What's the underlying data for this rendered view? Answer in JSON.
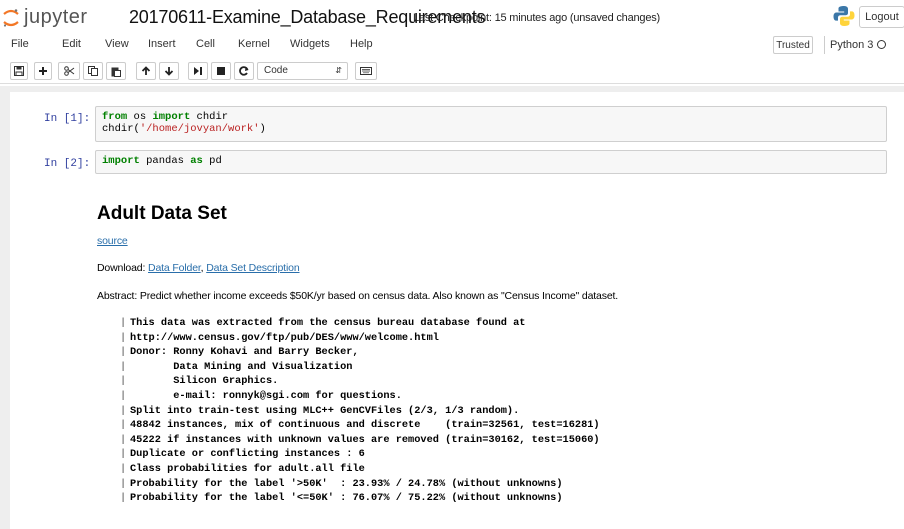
{
  "header": {
    "logo_text": "jupyter",
    "notebook_title": "20170611-Examine_Database_Requirements",
    "checkpoint": "Last Checkpoint: 15 minutes ago (unsaved changes)",
    "logout_label": "Logout"
  },
  "menubar": {
    "items": [
      "File",
      "Edit",
      "View",
      "Insert",
      "Cell",
      "Kernel",
      "Widgets",
      "Help"
    ],
    "trusted_label": "Trusted",
    "kernel_name": "Python 3"
  },
  "toolbar": {
    "buttons": [
      "save-icon",
      "add-icon",
      "cut-icon",
      "copy-icon",
      "paste-icon",
      "move-up-icon",
      "move-down-icon",
      "run-icon",
      "stop-icon",
      "restart-icon"
    ],
    "cell_type": "Code",
    "keyboard_icon": "keyboard-icon"
  },
  "cells": [
    {
      "prompt": "In [1]:",
      "lines": [
        [
          {
            "t": "from",
            "c": "kw"
          },
          {
            "t": " os "
          },
          {
            "t": "import",
            "c": "kw"
          },
          {
            "t": " chdir"
          }
        ],
        [
          {
            "t": "chdir("
          },
          {
            "t": "'/home/jovyan/work'",
            "c": "str"
          },
          {
            "t": ")"
          }
        ]
      ]
    },
    {
      "prompt": "In [2]:",
      "lines": [
        [
          {
            "t": "import",
            "c": "kw"
          },
          {
            "t": " pandas "
          },
          {
            "t": "as",
            "c": "kw"
          },
          {
            "t": " pd"
          }
        ]
      ]
    }
  ],
  "markdown": {
    "heading": "Adult Data Set",
    "source_link": "source",
    "download_label": "Download: ",
    "data_folder_link": "Data Folder",
    "link_separator": ", ",
    "description_link": "Data Set Description",
    "abstract": "Abstract: Predict whether income exceeds $50K/yr based on census data. Also known as \"Census Income\" dataset.",
    "pre_lines": [
      "This data was extracted from the census bureau database found at",
      "http://www.census.gov/ftp/pub/DES/www/welcome.html",
      "Donor: Ronny Kohavi and Barry Becker,",
      "       Data Mining and Visualization",
      "       Silicon Graphics.",
      "       e-mail: ronnyk@sgi.com for questions.",
      "Split into train-test using MLC++ GenCVFiles (2/3, 1/3 random).",
      "48842 instances, mix of continuous and discrete    (train=32561, test=16281)",
      "45222 if instances with unknown values are removed (train=30162, test=15060)",
      "Duplicate or conflicting instances : 6",
      "Class probabilities for adult.all file",
      "Probability for the label '>50K'  : 23.93% / 24.78% (without unknowns)",
      "Probability for the label '<=50K' : 76.07% / 75.22% (without unknowns)"
    ]
  },
  "colors": {
    "prompt": "#303f9f",
    "link": "#296eaa",
    "keyword": "#008000",
    "string": "#ba2121",
    "jupyter_orange": "#f37726"
  }
}
